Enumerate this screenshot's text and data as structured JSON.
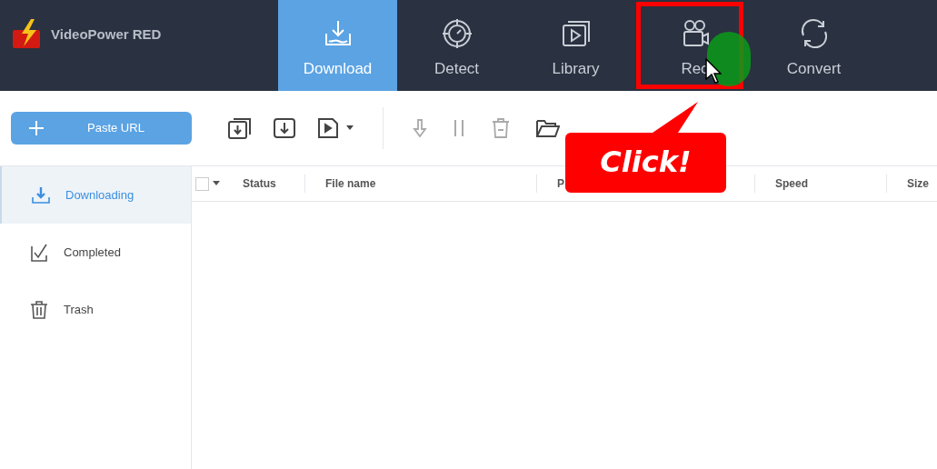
{
  "app": {
    "name": "VideoPower RED"
  },
  "tabs": [
    {
      "label": "Download",
      "kind": "download",
      "selected": true,
      "highlighted": false
    },
    {
      "label": "Detect",
      "kind": "detect",
      "selected": false,
      "highlighted": false
    },
    {
      "label": "Library",
      "kind": "library",
      "selected": false,
      "highlighted": false
    },
    {
      "label": "Rec",
      "kind": "record",
      "selected": false,
      "highlighted": true
    },
    {
      "label": "Convert",
      "kind": "convert",
      "selected": false,
      "highlighted": false
    }
  ],
  "toolbar": {
    "paste_button": "Paste URL"
  },
  "sidebar": {
    "items": [
      {
        "label": "Downloading",
        "kind": "download",
        "selected": true
      },
      {
        "label": "Completed",
        "kind": "check",
        "selected": false
      },
      {
        "label": "Trash",
        "kind": "trash",
        "selected": false
      }
    ]
  },
  "table": {
    "select_all": {
      "checked": false
    },
    "columns": [
      "Status",
      "File name",
      "P",
      "Speed",
      "Size"
    ]
  },
  "annotation": {
    "callout": "Click!"
  }
}
